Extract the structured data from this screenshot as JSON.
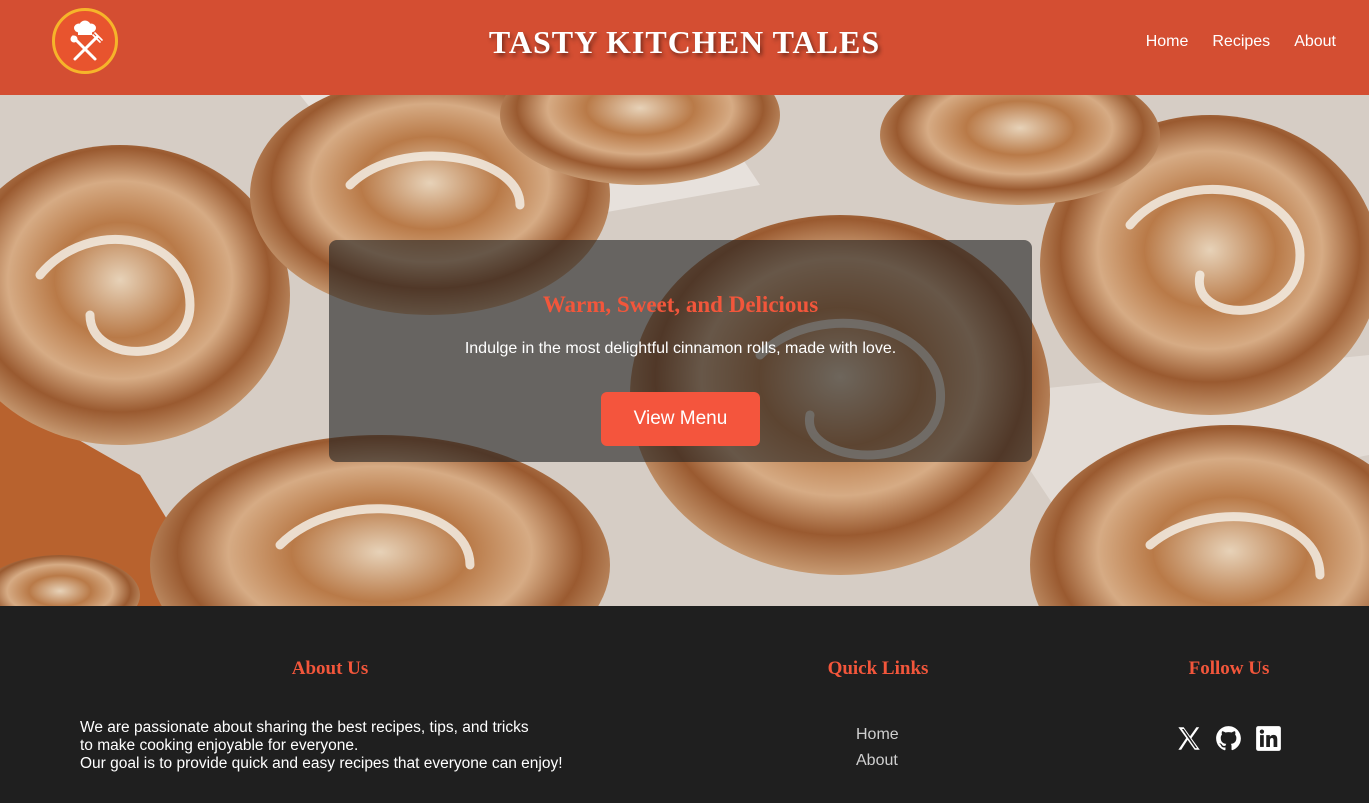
{
  "header": {
    "logo_icon": "chef-utensils-icon",
    "title": "TASTY KITCHEN TALES",
    "nav": [
      {
        "label": "Home"
      },
      {
        "label": "Recipes"
      },
      {
        "label": "About"
      }
    ]
  },
  "hero": {
    "image": "cinnamon-rolls-photo",
    "title": "Warm, Sweet, and Delicious",
    "subtitle": "Indulge in the most delightful cinnamon rolls, made with love.",
    "button_label": "View Menu"
  },
  "footer": {
    "about": {
      "heading": "About Us",
      "lines": [
        "We are passionate about sharing the best recipes, tips, and tricks",
        "to make cooking enjoyable for everyone.",
        "Our goal is to provide quick and easy recipes that everyone can enjoy!"
      ]
    },
    "quick_links": {
      "heading": "Quick Links",
      "links": [
        {
          "label": "Home"
        },
        {
          "label": "About"
        }
      ]
    },
    "follow": {
      "heading": "Follow Us",
      "icons": [
        "x-twitter-icon",
        "github-icon",
        "linkedin-icon"
      ]
    }
  },
  "colors": {
    "header_bg": "#d44e32",
    "accent": "#f2563b",
    "button": "#f4553d",
    "footer_bg": "#1f1f1f"
  }
}
